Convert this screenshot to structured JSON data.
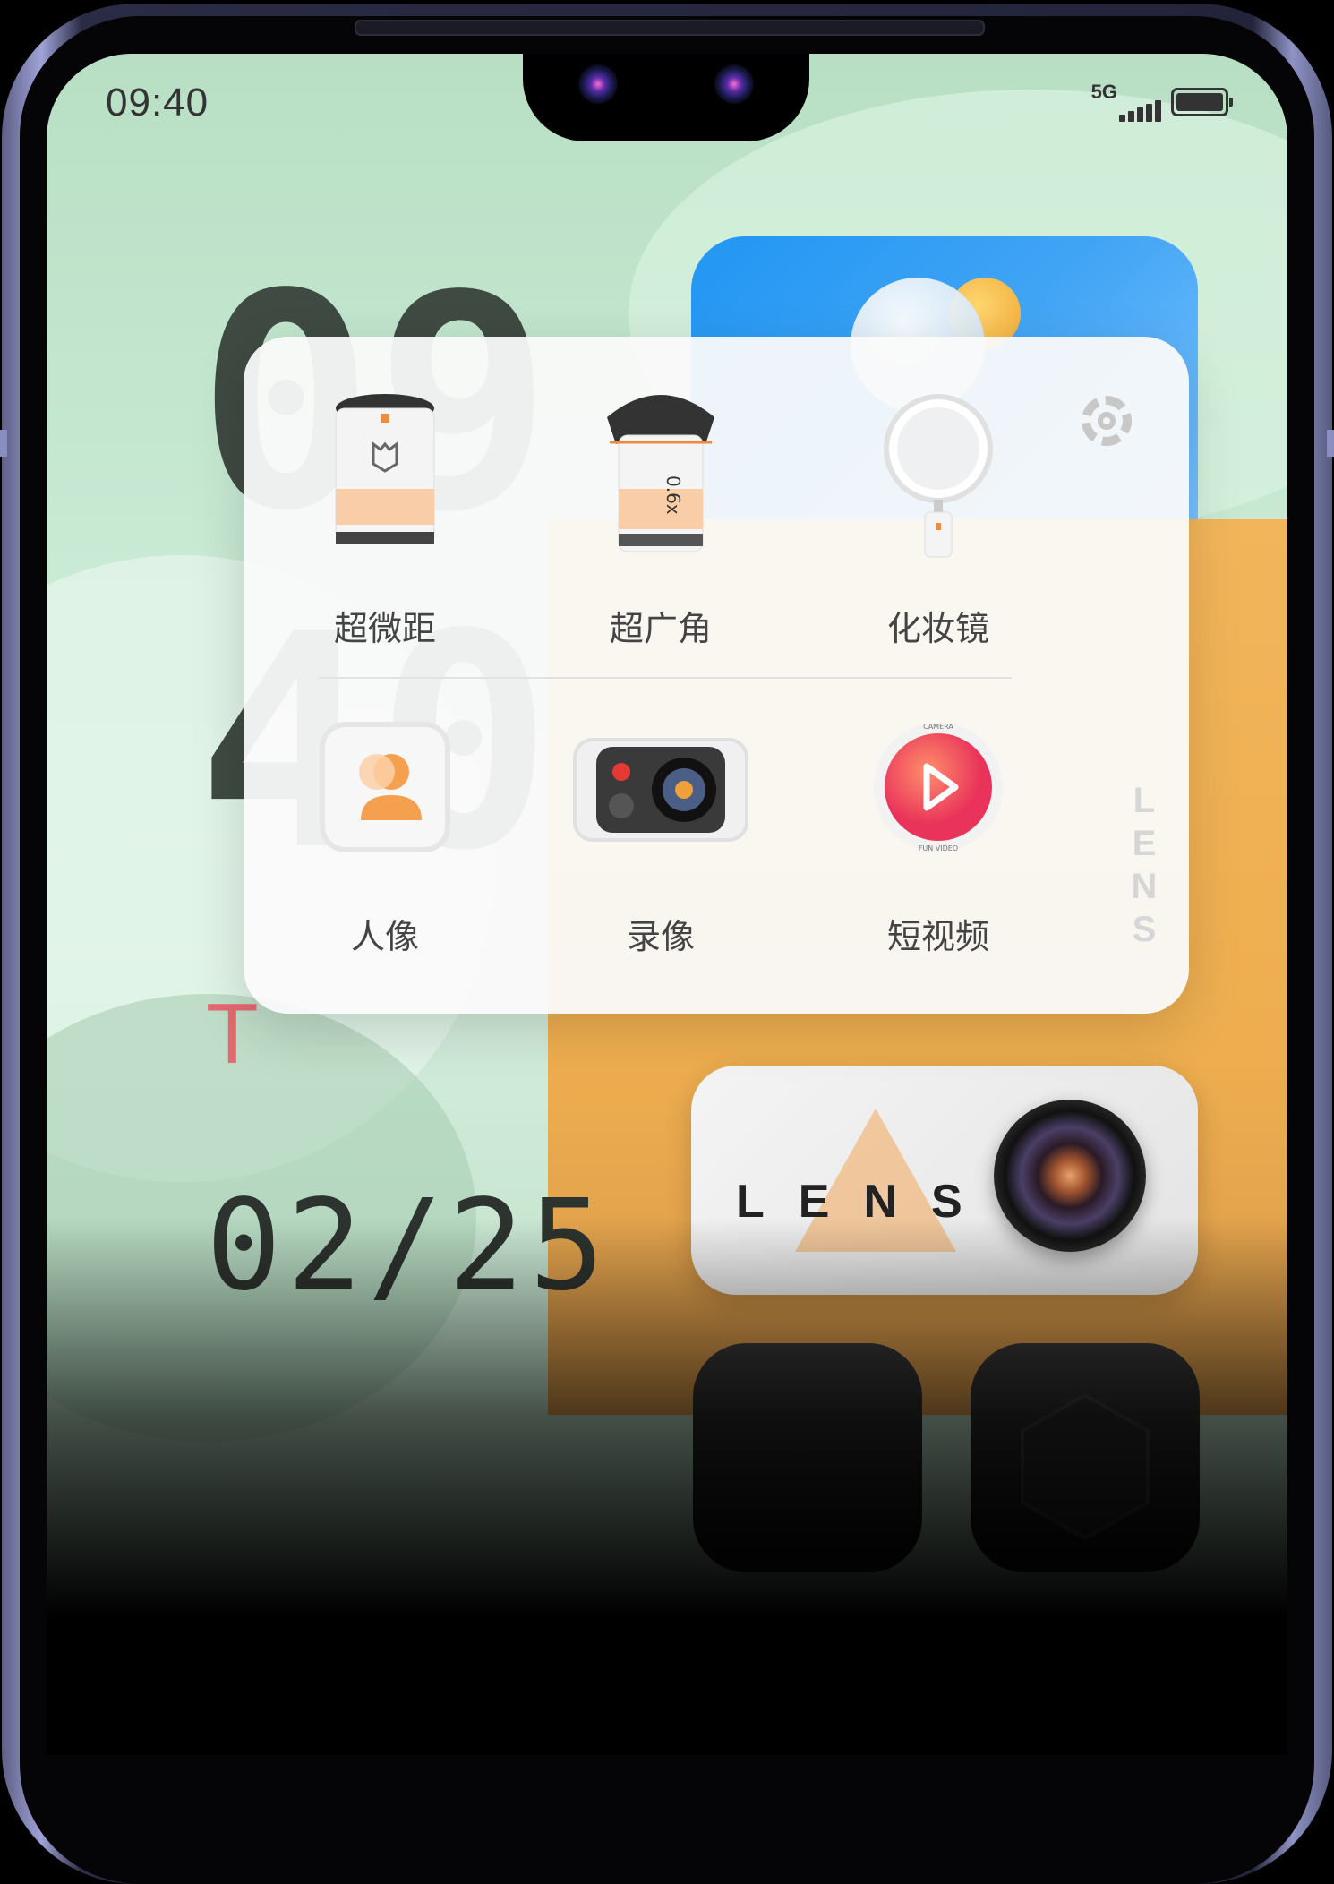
{
  "status_bar": {
    "time": "09:40",
    "network": "5G"
  },
  "home": {
    "clock_large": "09\n40",
    "clock_line1": "09",
    "clock_line2": "40",
    "day_letters": "T",
    "date": "02/25"
  },
  "widgets": {
    "lens_brand": "LENS",
    "camera_ring_text": "CAMERA"
  },
  "popup": {
    "side_label": "LENS",
    "tiles": [
      {
        "label": "超微距",
        "icon": "macro-lens-icon"
      },
      {
        "label": "超广角",
        "icon": "wide-angle-lens-icon"
      },
      {
        "label": "化妆镜",
        "icon": "makeup-mirror-icon"
      },
      {
        "label": "人像",
        "icon": "portrait-icon"
      },
      {
        "label": "录像",
        "icon": "video-record-icon"
      },
      {
        "label": "短视频",
        "icon": "short-video-icon"
      }
    ],
    "wide_lens_mark": "0.6x",
    "short_video_ring_top": "CAMERA",
    "short_video_ring_bottom": "FUN VIDEO"
  },
  "colors": {
    "accent_orange": "#f08a3c",
    "weather_blue": "#2196f3",
    "panel_orange": "#f2b55a",
    "day_red": "#e46a6f"
  }
}
